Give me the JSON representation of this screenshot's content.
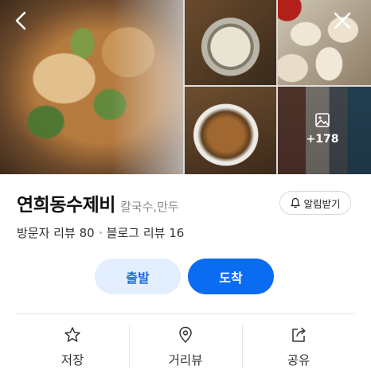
{
  "gallery": {
    "photos": [
      "pancake-photo",
      "soup-photo",
      "dumpling-photo",
      "noodle-photo",
      "storefront-photo"
    ],
    "more_count": "+178",
    "back_icon": "chevron-left-icon",
    "close_icon": "close-icon"
  },
  "place": {
    "name": "연희동수제비",
    "category": "칼국수,만두",
    "alarm_label": "알림받기"
  },
  "reviews": {
    "visitor_label": "방문자 리뷰",
    "visitor_count": "80",
    "blog_label": "블로그 리뷰",
    "blog_count": "16"
  },
  "route": {
    "start_label": "출발",
    "arrive_label": "도착"
  },
  "actions": {
    "save_label": "저장",
    "streetview_label": "거리뷰",
    "share_label": "공유"
  },
  "colors": {
    "accent": "#0a6cf0",
    "accent_light": "#e3efff",
    "accent_text": "#1b6ad6"
  }
}
